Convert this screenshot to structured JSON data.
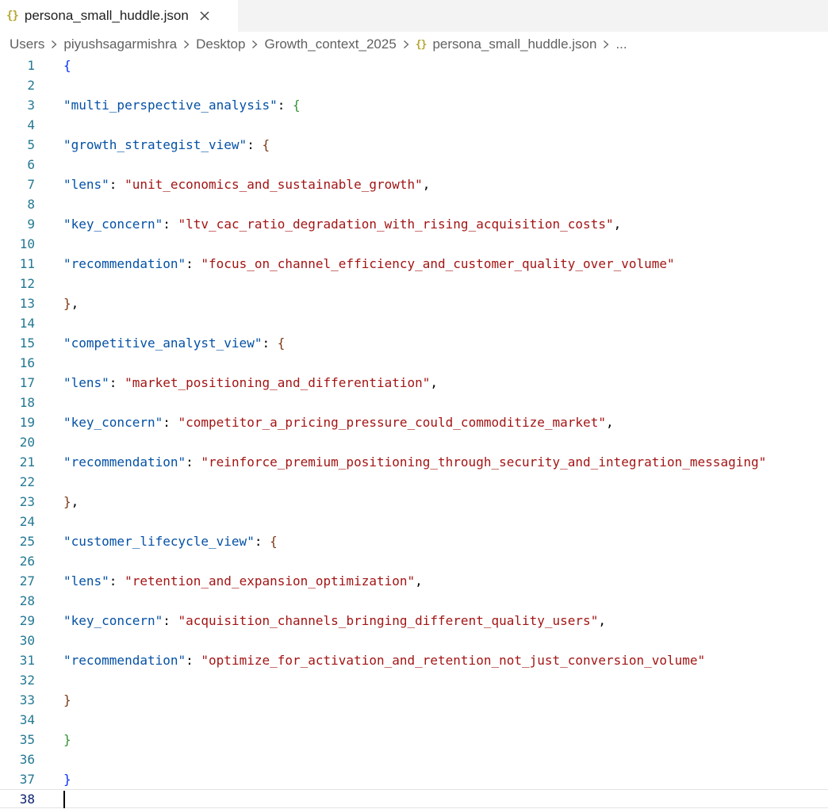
{
  "tab": {
    "icon": "{}",
    "title": "persona_small_huddle.json"
  },
  "breadcrumb": {
    "items": [
      "Users",
      "piyushsagarmishra",
      "Desktop",
      "Growth_context_2025"
    ],
    "file_icon": "{}",
    "file": "persona_small_huddle.json",
    "more": "..."
  },
  "editor": {
    "lines": [
      "{",
      "",
      "\"multi_perspective_analysis\": {",
      "",
      "\"growth_strategist_view\": {",
      "",
      "\"lens\": \"unit_economics_and_sustainable_growth\",",
      "",
      "\"key_concern\": \"ltv_cac_ratio_degradation_with_rising_acquisition_costs\",",
      "",
      "\"recommendation\": \"focus_on_channel_efficiency_and_customer_quality_over_volume\"",
      "",
      "},",
      "",
      "\"competitive_analyst_view\": {",
      "",
      "\"lens\": \"market_positioning_and_differentiation\",",
      "",
      "\"key_concern\": \"competitor_a_pricing_pressure_could_commoditize_market\",",
      "",
      "\"recommendation\": \"reinforce_premium_positioning_through_security_and_integration_messaging\"",
      "",
      "},",
      "",
      "\"customer_lifecycle_view\": {",
      "",
      "\"lens\": \"retention_and_expansion_optimization\",",
      "",
      "\"key_concern\": \"acquisition_channels_bringing_different_quality_users\",",
      "",
      "\"recommendation\": \"optimize_for_activation_and_retention_not_just_conversion_volume\"",
      "",
      "}",
      "",
      "}",
      "",
      "}",
      ""
    ],
    "current_line": 38
  },
  "colors": {
    "key": "#0451a5",
    "string": "#a31515",
    "bracket_level1": "#0431fa",
    "bracket_level2": "#319331",
    "bracket_level3": "#7b3814",
    "line_number": "#237893",
    "json_icon": "#b5a72f"
  }
}
